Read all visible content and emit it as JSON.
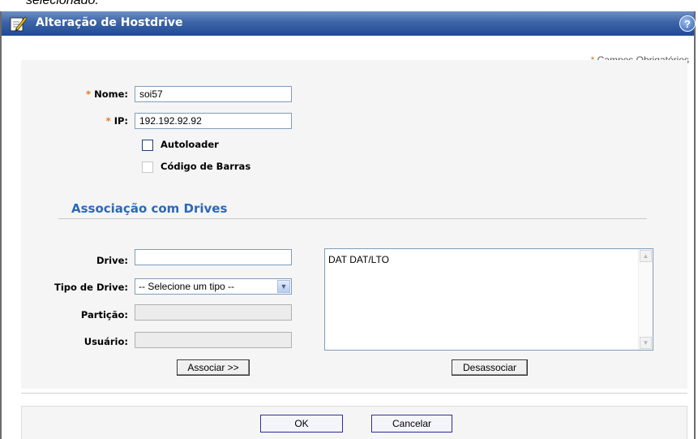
{
  "caption": "selecionado.",
  "dialog": {
    "title": "Alteração de Hostdrive",
    "help_label": "?"
  },
  "required_note": {
    "asterisk": "*",
    "text": "Campos Obrigatórios"
  },
  "form": {
    "nome": {
      "asterisk": "*",
      "label": "Nome:",
      "value": "soi57"
    },
    "ip": {
      "asterisk": "*",
      "label": "IP:",
      "value": "192.192.92.92"
    },
    "autoloader": {
      "label": "Autoloader",
      "checked": false
    },
    "codigo_barras": {
      "label": "Código de Barras",
      "checked": false
    }
  },
  "association": {
    "title": "Associação com Drives",
    "drive": {
      "label": "Drive:",
      "value": ""
    },
    "tipo_drive": {
      "label": "Tipo de Drive:",
      "selected": "-- Selecione um tipo --"
    },
    "particao": {
      "label": "Partição:",
      "value": ""
    },
    "usuario": {
      "label": "Usuário:",
      "value": ""
    },
    "list_items": [
      "DAT DAT/LTO"
    ],
    "associar_button": "Associar >>",
    "desassociar_button": "Desassociar"
  },
  "footer": {
    "ok_button": "OK",
    "cancel_button": "Cancelar"
  },
  "colors": {
    "titlebar": "#2a56a0",
    "accent": "#2a69b8",
    "required": "#e07a1a"
  }
}
